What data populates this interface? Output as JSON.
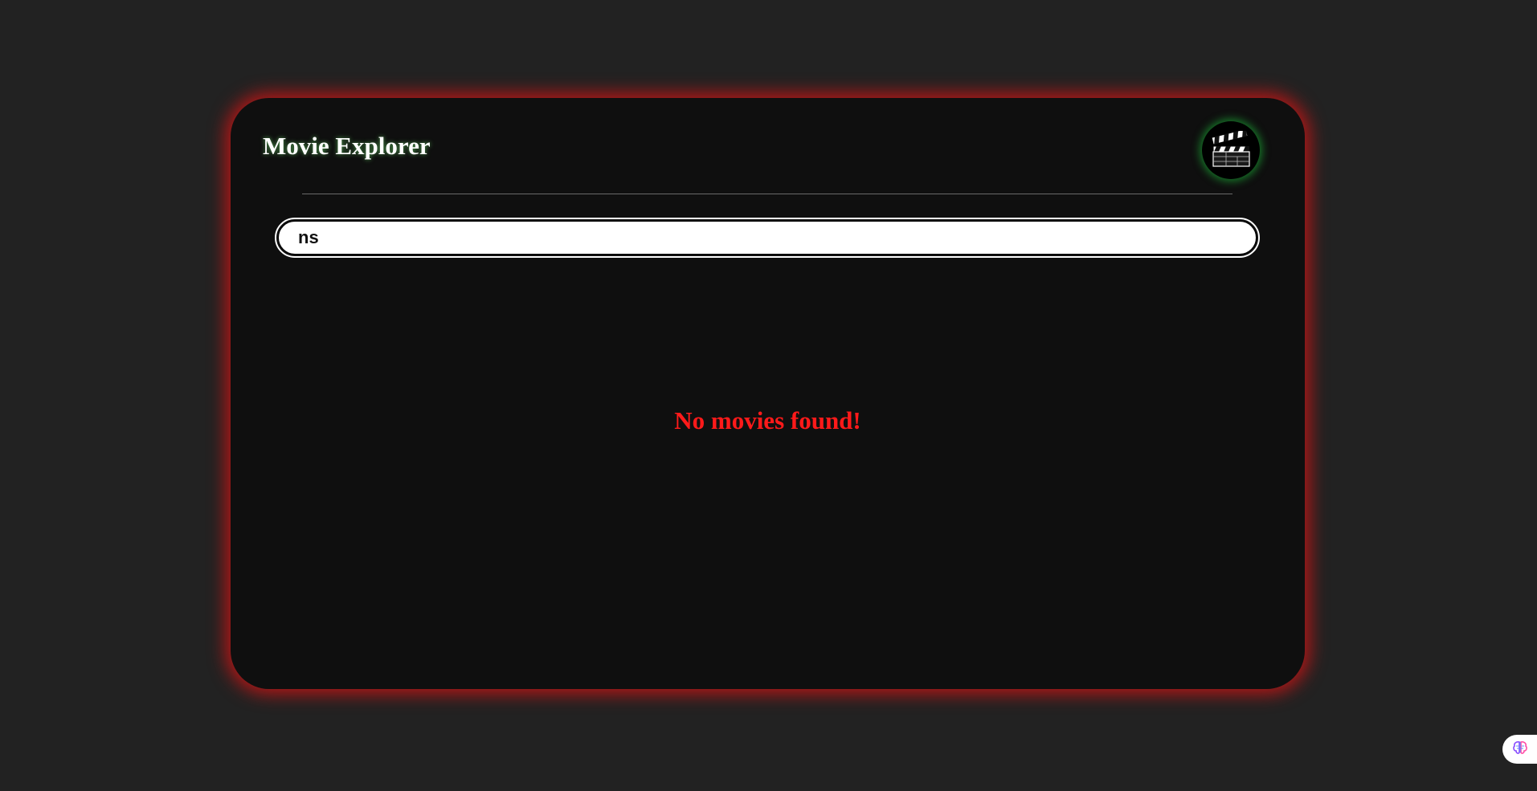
{
  "app": {
    "title": "Movie Explorer",
    "logo_icon": "clapperboard-icon"
  },
  "search": {
    "value": "ns",
    "placeholder": ""
  },
  "results": {
    "empty_message": "No movies found!"
  },
  "colors": {
    "background": "#222222",
    "card": "#0f0f0f",
    "card_glow": "#d21414",
    "logo_glow": "#1ec83c",
    "empty_message": "#ff1a1a"
  },
  "extension": {
    "icon": "brain-icon"
  }
}
